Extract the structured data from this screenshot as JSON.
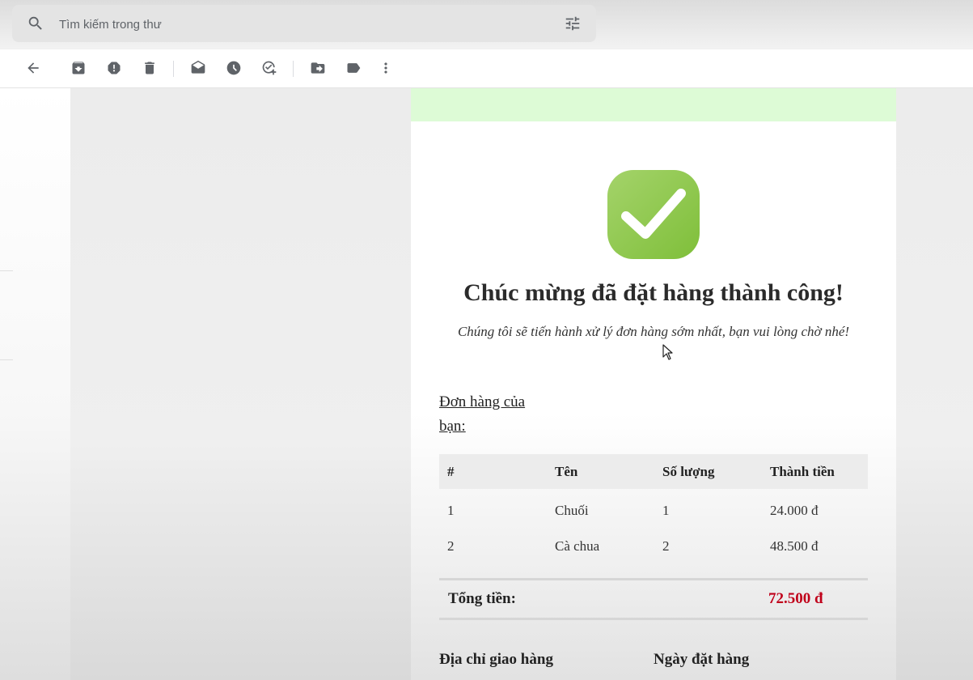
{
  "search": {
    "placeholder": "Tìm kiếm trong thư",
    "search_icon": "search-icon",
    "options_icon": "tune-icon"
  },
  "toolbar": {
    "icons": [
      "back-arrow-icon",
      "archive-icon",
      "report-spam-icon",
      "delete-icon",
      "mark-unread-icon",
      "snooze-icon",
      "add-task-icon",
      "move-to-icon",
      "label-icon",
      "more-vert-icon"
    ]
  },
  "email": {
    "banner_color": "#ddfbd6",
    "icon": "checkmark-icon",
    "icon_color": "#8cc63f",
    "title": "Chúc mừng đã đặt hàng thành công!",
    "subtitle": "Chúng tôi sẽ tiến hành xử lý đơn hàng sớm nhất, bạn vui lòng chờ nhé!",
    "order_link_line1": "Đơn hàng của",
    "order_link_line2": "bạn:",
    "table": {
      "headers": [
        "#",
        "Tên",
        "Số lượng",
        "Thành tiền"
      ],
      "rows": [
        [
          "1",
          "Chuối",
          "1",
          "24.000 đ"
        ],
        [
          "2",
          "Cà chua",
          "2",
          "48.500 đ"
        ]
      ]
    },
    "total_label": "Tổng tiền:",
    "total_value": "72.500 đ",
    "total_color": "#c0001a",
    "address_heading": "Địa chỉ giao hàng",
    "date_heading": "Ngày đặt hàng"
  }
}
